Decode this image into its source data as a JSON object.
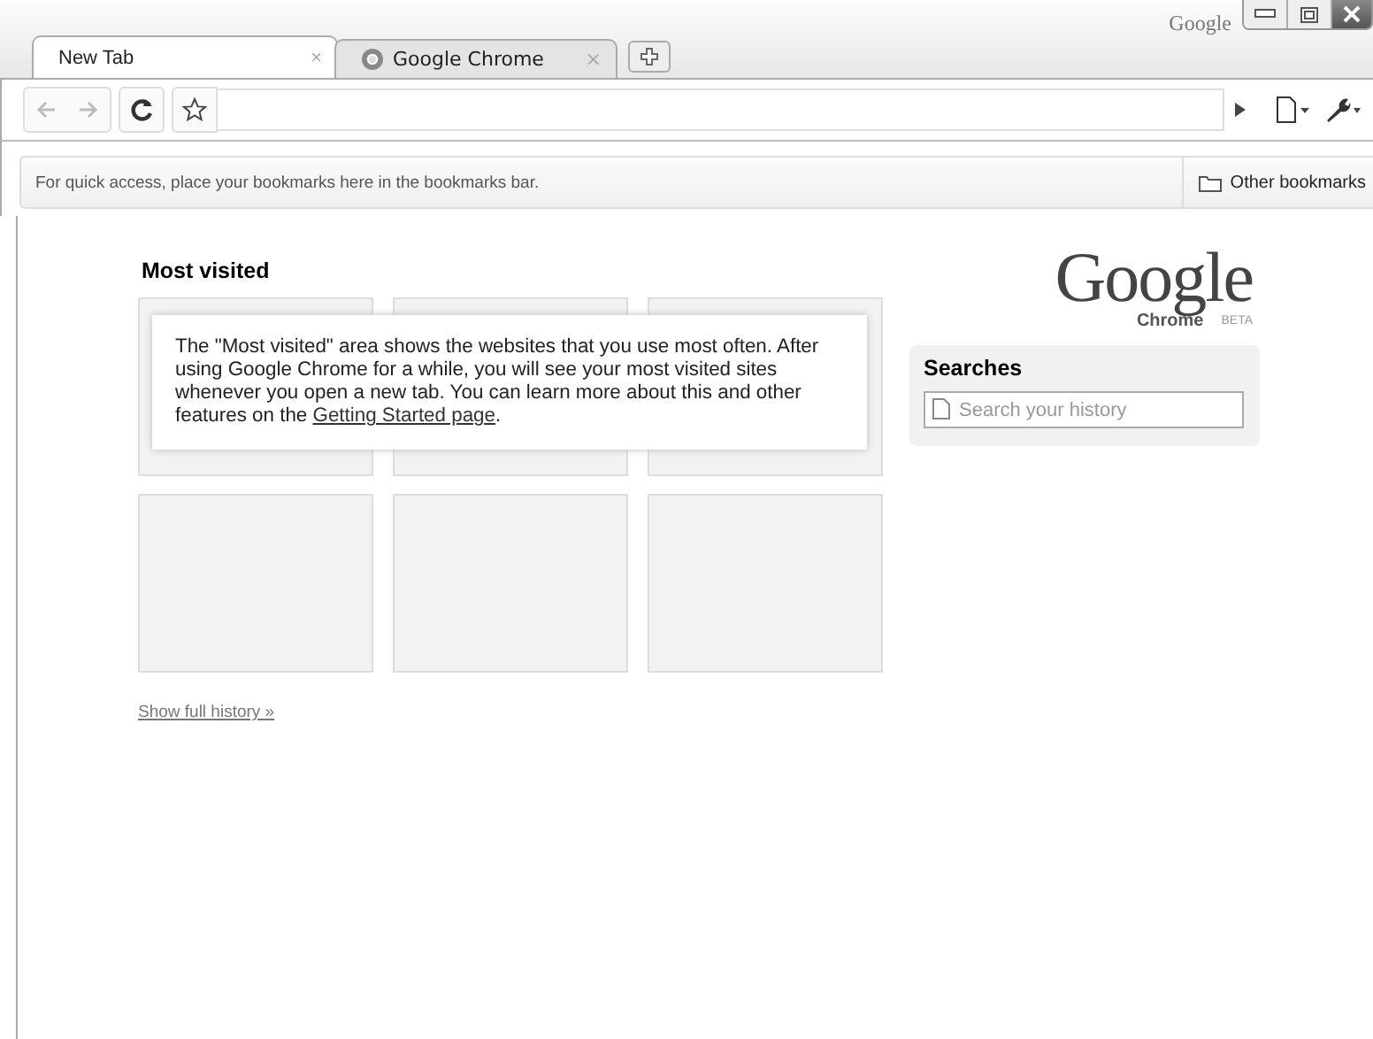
{
  "window": {
    "brand": "Google"
  },
  "tabs": [
    {
      "title": "New Tab",
      "close": "×",
      "selected": true
    },
    {
      "title": "Google Chrome",
      "close": "×",
      "selected": false
    }
  ],
  "bookmarks_bar": {
    "message": "For quick access, place your bookmarks here in the bookmarks bar.",
    "other": "Other bookmarks"
  },
  "most_visited": {
    "heading": "Most visited",
    "message_before": "The \"Most visited\" area shows the websites that you use most often. After using Google Chrome for a while, you will see your most visited sites whenever you open a new tab. You can learn more about this and other features on the ",
    "link": "Getting Started page",
    "message_after": ".",
    "show_history": "Show full history »"
  },
  "logo": {
    "wordmark": "Google",
    "product": "Chrome",
    "badge": "BETA"
  },
  "searches": {
    "heading": "Searches",
    "placeholder": "Search your history"
  }
}
